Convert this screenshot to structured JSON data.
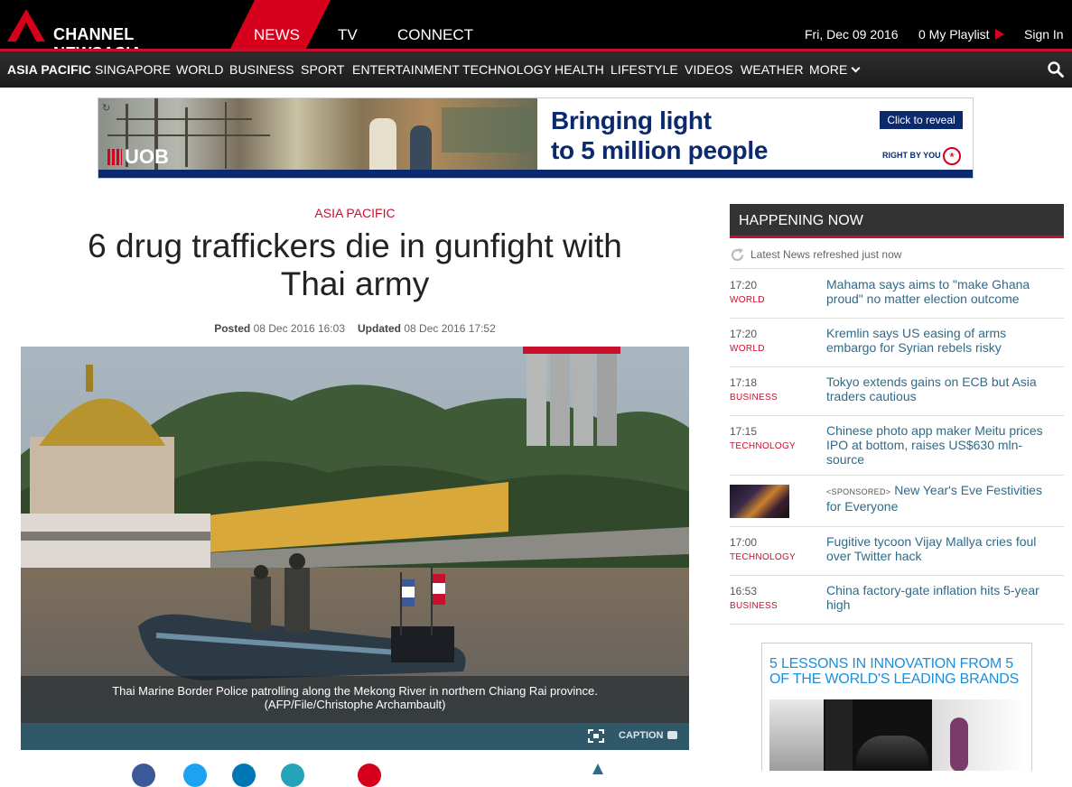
{
  "header": {
    "logo_text": "CHANNEL NEWSASIA",
    "tabs": [
      {
        "label": "NEWS",
        "active": true
      },
      {
        "label": "TV",
        "active": false
      },
      {
        "label": "CONNECT",
        "active": false
      }
    ],
    "date": "Fri, Dec 09 2016",
    "playlist": "0 My Playlist",
    "sign_in": "Sign In"
  },
  "nav": {
    "items": [
      {
        "label": "ASIA PACIFIC",
        "active": true
      },
      {
        "label": "SINGAPORE"
      },
      {
        "label": "WORLD"
      },
      {
        "label": "BUSINESS"
      },
      {
        "label": "SPORT"
      },
      {
        "label": "ENTERTAINMENT"
      },
      {
        "label": "TECHNOLOGY"
      },
      {
        "label": "HEALTH"
      },
      {
        "label": "LIFESTYLE"
      },
      {
        "label": "VIDEOS"
      },
      {
        "label": "WEATHER"
      },
      {
        "label": "MORE"
      }
    ],
    "icons": {
      "search": "search-icon",
      "more": "chevron-down-icon"
    }
  },
  "ad": {
    "brand": "UOB",
    "headline_line1": "Bringing light",
    "headline_line2": "to 5 million people",
    "cta": "Click to reveal",
    "tagline": "RIGHT BY YOU"
  },
  "article": {
    "section": "ASIA PACIFIC",
    "headline": "6 drug traffickers die in gunfight with Thai army",
    "posted_label": "Posted",
    "posted_value": "08 Dec 2016 16:03",
    "updated_label": "Updated",
    "updated_value": "08 Dec 2016 17:52",
    "photo_caption": "Thai Marine Border Police patrolling along the Mekong River in northern Chiang Rai province. (AFP/File/Christophe Archambault)",
    "caption_button": "CAPTION"
  },
  "sidebar": {
    "title": "HAPPENING NOW",
    "refresh_text": "Latest News refreshed just now",
    "items": [
      {
        "time": "17:20",
        "category": "WORLD",
        "headline": "Mahama says aims to \"make Ghana proud\" no matter election outcome"
      },
      {
        "time": "17:20",
        "category": "WORLD",
        "headline": "Kremlin says US easing of arms embargo for Syrian rebels risky"
      },
      {
        "time": "17:18",
        "category": "BUSINESS",
        "headline": "Tokyo extends gains on ECB but Asia traders cautious"
      },
      {
        "time": "17:15",
        "category": "TECHNOLOGY",
        "headline": "Chinese photo app maker Meitu prices IPO at bottom, raises US$630 mln-source"
      },
      {
        "sponsored_label": "<SPONSORED>",
        "headline": "New Year's Eve Festivities for Everyone"
      },
      {
        "time": "17:00",
        "category": "TECHNOLOGY",
        "headline": "Fugitive tycoon Vijay Mallya cries foul over Twitter hack"
      },
      {
        "time": "16:53",
        "category": "BUSINESS",
        "headline": "China factory-gate inflation hits 5-year high"
      }
    ],
    "ad_title": "5 LESSONS IN INNOVATION FROM 5 OF THE WORLD'S LEADING BRANDS"
  },
  "colors": {
    "brand_red": "#c8102e",
    "link_blue": "#2e6b8a",
    "nav_dark": "#1c1c1c"
  }
}
